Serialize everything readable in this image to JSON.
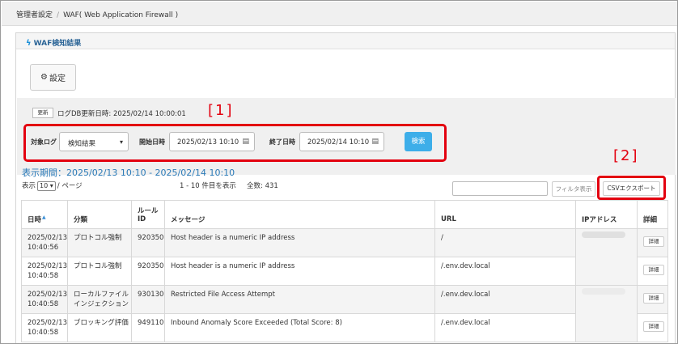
{
  "breadcrumb": {
    "items": [
      "管理者設定",
      "WAF( Web Application Firewall )"
    ],
    "separator": "/"
  },
  "panel": {
    "title": "WAF検知結果",
    "title_icon": "waf-icon"
  },
  "settings_button": {
    "label": "設定",
    "icon": "gear-icon"
  },
  "update": {
    "button_label": "更新",
    "text": "ログDB更新日時: 2025/02/14 10:00:01"
  },
  "filter": {
    "target_label": "対象ログ",
    "target_value": "検知結果",
    "start_label": "開始日時",
    "start_value": "2025/02/13 10:10",
    "end_label": "終了日時",
    "end_value": "2025/02/14 10:10",
    "search_label": "検索"
  },
  "annotations": {
    "label1": "[1]",
    "label2": "[2]"
  },
  "period_text": "表示期間：2025/02/13 10:10 - 2025/02/14 10:10",
  "list_toolbar": {
    "show_label": "表示",
    "page_size": "10",
    "per_page_label": "/ ページ",
    "range_text": "1 - 10 件目を表示",
    "total_text": "全数: 431",
    "filter_placeholder": "",
    "filter_button": "フィルタ表示",
    "csv_button": "CSVエクスポート"
  },
  "table": {
    "headers": {
      "date": "日時",
      "category": "分類",
      "rule_id_1": "ルール",
      "rule_id_2": "ID",
      "message": "メッセージ",
      "url": "URL",
      "ip": "IPアドレス",
      "detail": "詳細"
    },
    "detail_label": "詳細",
    "rows": [
      {
        "date": "2025/02/13",
        "time": "10:40:56",
        "category_1": "プロトコル強制",
        "category_2": "",
        "rule_id": "920350",
        "message": "Host header is a numeric IP address",
        "url": "/"
      },
      {
        "date": "2025/02/13",
        "time": "10:40:58",
        "category_1": "プロトコル強制",
        "category_2": "",
        "rule_id": "920350",
        "message": "Host header is a numeric IP address",
        "url": "/.env.dev.local"
      },
      {
        "date": "2025/02/13",
        "time": "10:40:58",
        "category_1": "ローカルファイル",
        "category_2": "インジェクション",
        "rule_id": "930130",
        "message": "Restricted File Access Attempt",
        "url": "/.env.dev.local"
      },
      {
        "date": "2025/02/13",
        "time": "10:40:58",
        "category_1": "ブロッキング評価",
        "category_2": "",
        "rule_id": "949110",
        "message": "Inbound Anomaly Score Exceeded (Total Score: 8)",
        "url": "/.env.dev.local"
      }
    ]
  },
  "colors": {
    "highlight_red": "#e3000f",
    "search_blue": "#3daee9",
    "link_blue": "#2a7ab8"
  }
}
